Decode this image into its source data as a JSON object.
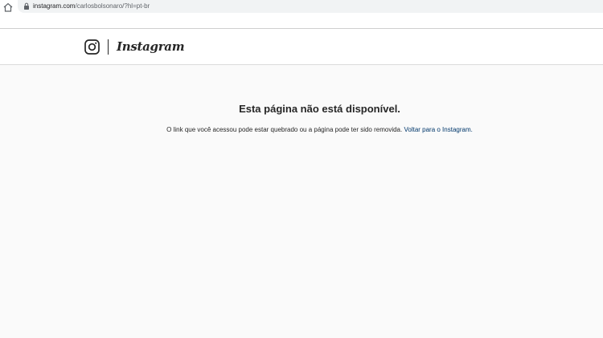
{
  "browser": {
    "url_host": "instagram.com",
    "url_path": "/carlosbolsonaro/?hl=pt-br"
  },
  "header": {
    "logo_icon": "instagram-glyph-icon",
    "wordmark": "Instagram"
  },
  "error": {
    "title": "Esta página não está disponível.",
    "message": "O link que você acessou pode estar quebrado ou a página pode ter sido removida.",
    "link_label": "Voltar para o Instagram."
  },
  "colors": {
    "background": "#fafafa",
    "text": "#262626",
    "link": "#00376b",
    "border": "#dbdbdb"
  }
}
